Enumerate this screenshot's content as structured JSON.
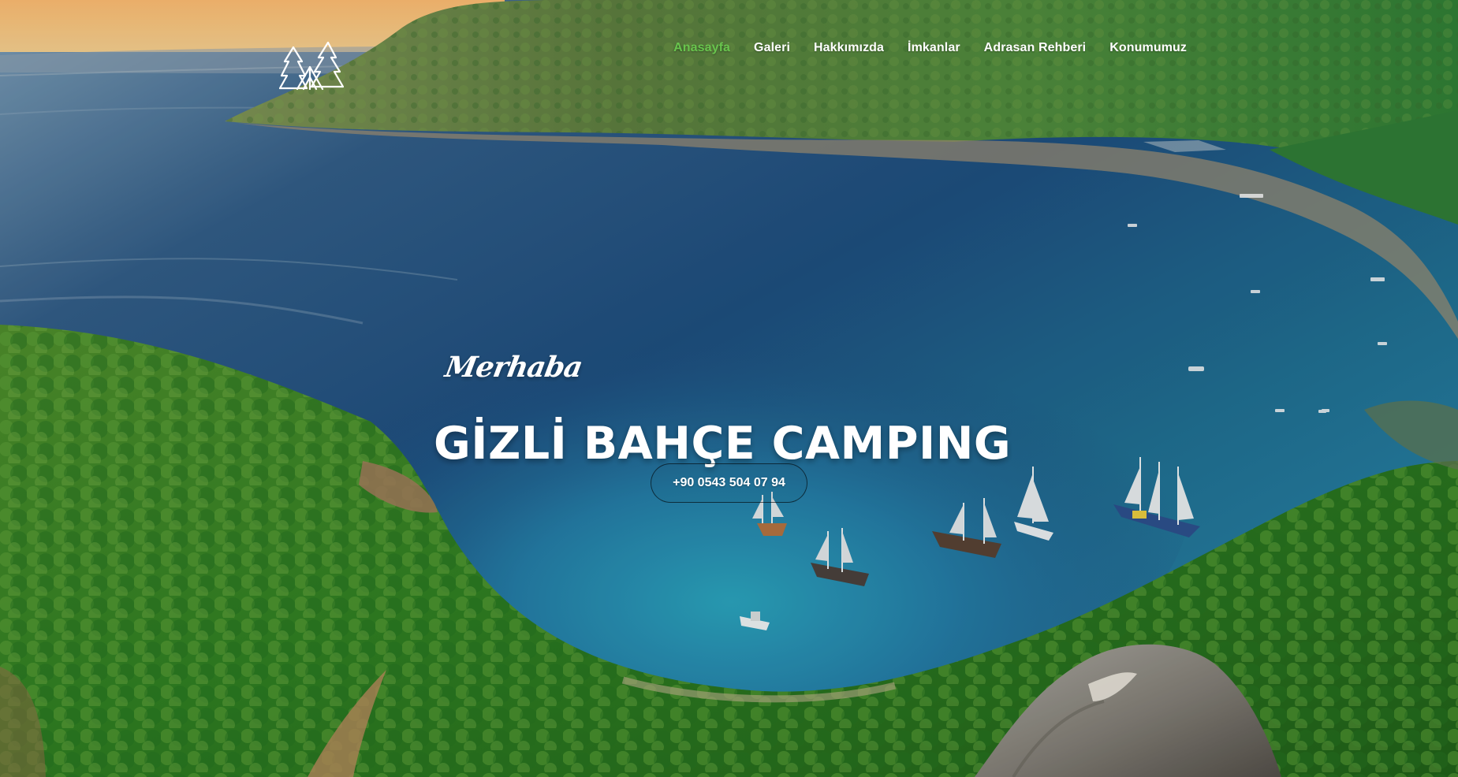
{
  "brand": {
    "logo_icon": "tree-tent-logo-icon",
    "logo_color": "#ffffff"
  },
  "nav": {
    "items": [
      {
        "label": "Anasayfa",
        "active": true
      },
      {
        "label": "Galeri",
        "active": false
      },
      {
        "label": "Hakkımızda",
        "active": false
      },
      {
        "label": "İmkanlar",
        "active": false
      },
      {
        "label": "Adrasan Rehberi",
        "active": false
      },
      {
        "label": "Konumumuz",
        "active": false
      }
    ],
    "active_color": "#68c44d",
    "text_color": "#ffffff"
  },
  "hero": {
    "greeting": "Merhaba",
    "title": "GİZLİ BAHÇE CAMPING",
    "phone": "+90 0543 504 07 94"
  },
  "background": {
    "sea": "#1f5f93",
    "forest": "#2f7b28",
    "sky": "#f2bf7a"
  }
}
